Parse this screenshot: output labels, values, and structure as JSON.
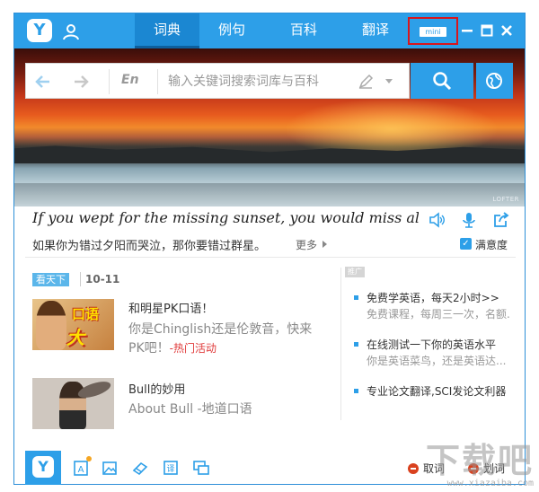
{
  "titlebar": {
    "tabs": [
      {
        "label": "词典",
        "active": true
      },
      {
        "label": "例句",
        "active": false
      },
      {
        "label": "百科",
        "active": false
      },
      {
        "label": "翻译",
        "active": false
      }
    ],
    "mini_label": "mini"
  },
  "banner": {
    "watermark": "LOFTER"
  },
  "search": {
    "lang": "En",
    "placeholder": "输入关键词搜索词库与百科"
  },
  "sentence": {
    "english": "If you wept for the missing sunset, you would miss all t...",
    "chinese": "如果你为错过夕阳而哭泣，那你要错过群星。",
    "more": "更多",
    "satisfaction_label": "满意度",
    "satisfaction_checked": true
  },
  "feed": {
    "badge": "看天下",
    "date": "10-11",
    "items": [
      {
        "title": "和明星PK口语！",
        "desc_line1": "你是Chinglish还是伦敦音，快来",
        "desc_line2": "PK吧！",
        "tag": "-热门活动",
        "thumb_text1": "口语",
        "thumb_text2": "大PK!"
      },
      {
        "title": "Bull的妙用",
        "desc_line1": "About Bull -地道口语"
      }
    ]
  },
  "ads": {
    "tag": "推广",
    "items": [
      {
        "title": "免费学英语，每天2小时>>",
        "desc": "免费课程，每周三一次，名额..."
      },
      {
        "title": "在线测试一下你的英语水平",
        "desc": "你是英语菜鸟，还是英语达..."
      },
      {
        "title": "专业论文翻译,SCI发论文利器",
        "desc": ""
      }
    ]
  },
  "bottombar": {
    "toggle1_label": "取词",
    "toggle2_label": "划词"
  },
  "site_watermark": {
    "big": "下载吧",
    "small": "www.xiazaiba.com"
  },
  "colors": {
    "accent": "#2d9fe8",
    "highlight_border": "#d8161d",
    "tag_red": "#e03a3a"
  }
}
